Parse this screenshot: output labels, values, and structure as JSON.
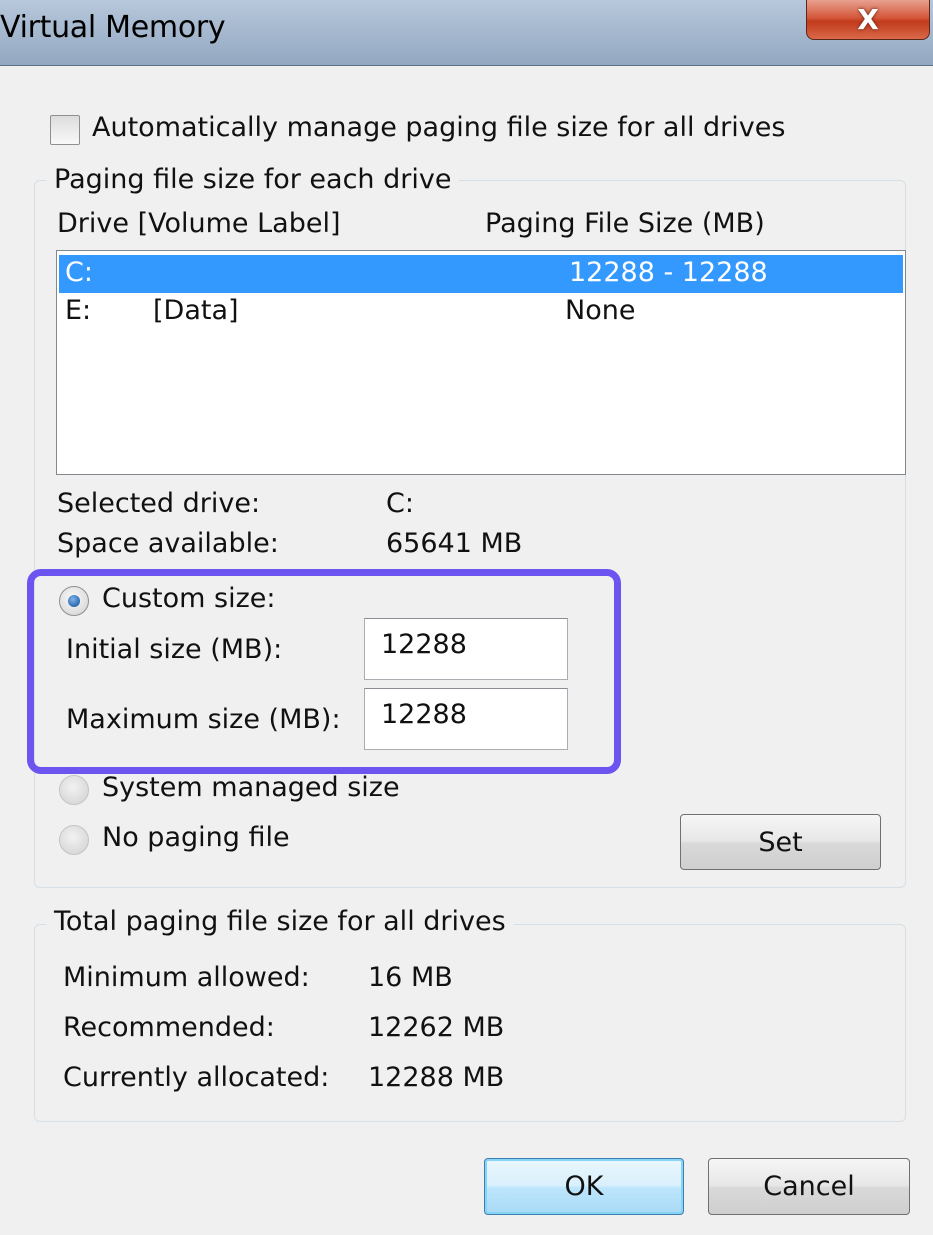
{
  "window": {
    "title": "Virtual Memory",
    "close_glyph": "X"
  },
  "auto_manage": {
    "label": "Automatically manage paging file size for all drives",
    "checked": false
  },
  "paging_group": {
    "title": "Paging file size for each drive",
    "col_drive": "Drive  [Volume Label]",
    "col_size": "Paging File Size (MB)",
    "drives": [
      {
        "drive": "C:",
        "label": "",
        "size": "12288 - 12288",
        "selected": true
      },
      {
        "drive": "E:",
        "label": "[Data]",
        "size": "None",
        "selected": false
      }
    ],
    "selected_drive_label": "Selected drive:",
    "selected_drive_value": "C:",
    "space_available_label": "Space available:",
    "space_available_value": "65641 MB",
    "custom_size_label": "Custom size:",
    "initial_size_label": "Initial size (MB):",
    "initial_size_value": "12288",
    "maximum_size_label": "Maximum size (MB):",
    "maximum_size_value": "12288",
    "system_managed_label": "System managed size",
    "no_paging_label": "No paging file",
    "set_button": "Set"
  },
  "total_group": {
    "title": "Total paging file size for all drives",
    "minimum_label": "Minimum allowed:",
    "minimum_value": "16 MB",
    "recommended_label": "Recommended:",
    "recommended_value": "12262 MB",
    "allocated_label": "Currently allocated:",
    "allocated_value": "12288 MB"
  },
  "buttons": {
    "ok": "OK",
    "cancel": "Cancel"
  },
  "colors": {
    "selection": "#3399ff",
    "highlight_box": "#6b54f0"
  }
}
